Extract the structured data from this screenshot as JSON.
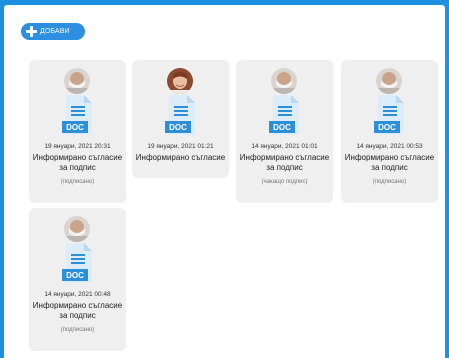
{
  "toolbar": {
    "add_label": "ДОБАВИ"
  },
  "cards": [
    {
      "date": "19 януари, 2021 20:31",
      "title": "Информирано съгласие за подпис",
      "status": "(подписано)",
      "avatar": "mask",
      "doc_label": "DOC"
    },
    {
      "date": "19 януари, 2021 01:21",
      "title": "Информирано съгласие",
      "status": "",
      "avatar": "woman",
      "doc_label": "DOC"
    },
    {
      "date": "14 януари, 2021 01:01",
      "title": "Информирано съгласие за подпис",
      "status": "(чакащо подпис)",
      "avatar": "mask",
      "doc_label": "DOC"
    },
    {
      "date": "14 януари, 2021 00:53",
      "title": "Информирано съгласие за подпис",
      "status": "(подписано)",
      "avatar": "mask",
      "doc_label": "DOC"
    },
    {
      "date": "14 януари, 2021 00:48",
      "title": "Информирано съгласие за подпис",
      "status": "(подписано)",
      "avatar": "mask",
      "doc_label": "DOC"
    }
  ],
  "colors": {
    "page_bg": "#1e90e0",
    "card_bg": "#efefef",
    "doc_blue": "#2d8fd8",
    "doc_light": "#dcecf8"
  }
}
